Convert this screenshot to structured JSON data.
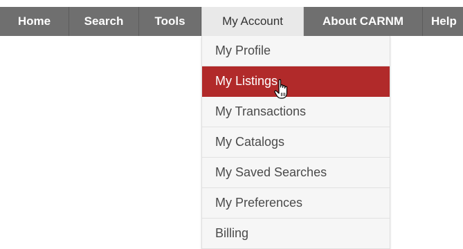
{
  "navbar": {
    "items": [
      {
        "label": "Home"
      },
      {
        "label": "Search"
      },
      {
        "label": "Tools"
      },
      {
        "label": "My Account"
      },
      {
        "label": "About CARNM"
      },
      {
        "label": "Help"
      }
    ]
  },
  "dropdown": {
    "items": [
      {
        "label": "My Profile"
      },
      {
        "label": "My Listings"
      },
      {
        "label": "My Transactions"
      },
      {
        "label": "My Catalogs"
      },
      {
        "label": "My Saved Searches"
      },
      {
        "label": "My Preferences"
      },
      {
        "label": "Billing"
      }
    ],
    "highlighted_color": "#b12a2a"
  },
  "cursor": {
    "icon": "hand-pointer-icon"
  }
}
